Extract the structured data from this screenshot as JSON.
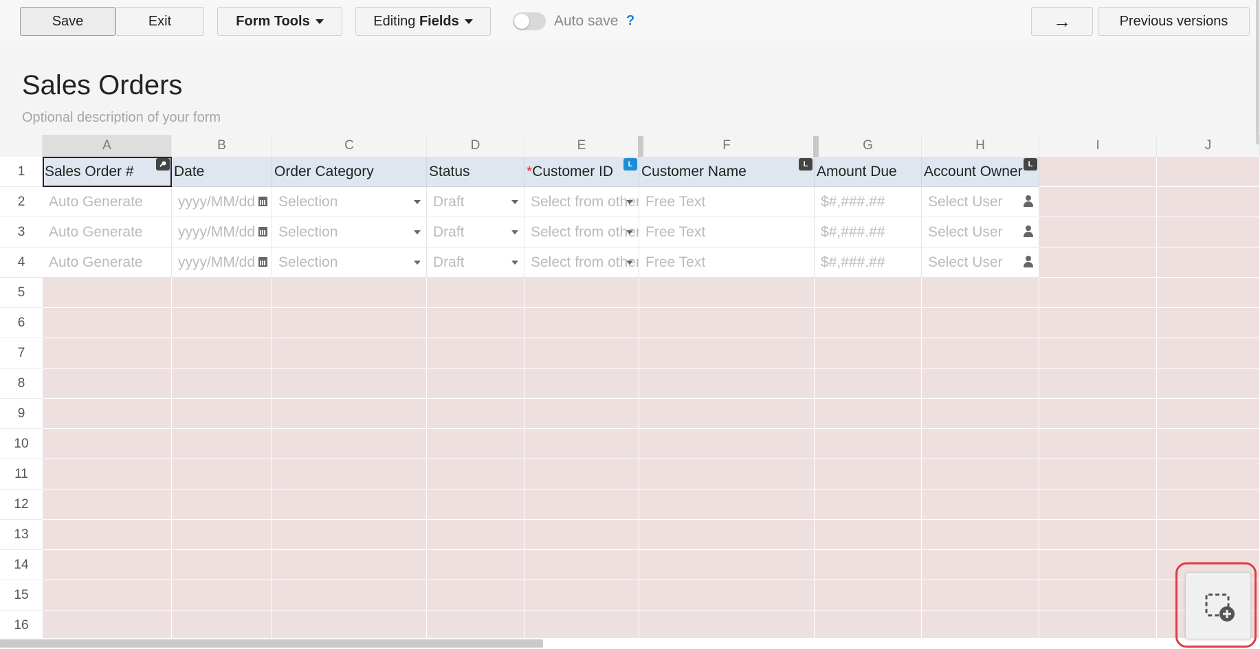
{
  "toolbar": {
    "save_label": "Save",
    "exit_label": "Exit",
    "form_tools_label": "Form Tools",
    "editing_prefix": "Editing ",
    "editing_bold": "Fields",
    "autosave_label": "Auto save",
    "autosave_enabled": false,
    "help_label": "?",
    "arrow_label": "→",
    "previous_versions_label": "Previous versions"
  },
  "form": {
    "title": "Sales Orders",
    "description": "Optional description of your form"
  },
  "grid": {
    "columns": [
      "A",
      "B",
      "C",
      "D",
      "E",
      "F",
      "G",
      "H",
      "I",
      "J"
    ],
    "rows": [
      "1",
      "2",
      "3",
      "4",
      "5",
      "6",
      "7",
      "8",
      "9",
      "10",
      "11",
      "12",
      "13",
      "14",
      "15",
      "16"
    ],
    "fields": [
      {
        "label": "Sales Order #",
        "placeholder": "Auto Generate",
        "icon": "key-icon"
      },
      {
        "label": "Date",
        "placeholder": "yyyy/MM/dd",
        "icon": "calendar-icon"
      },
      {
        "label": "Order Category",
        "placeholder": "Selection",
        "icon": "dropdown-icon"
      },
      {
        "label": "Status",
        "placeholder": "Draft",
        "icon": "dropdown-icon"
      },
      {
        "label": "Customer ID",
        "required": "*",
        "placeholder": "Select from other",
        "icon": "dropdown-icon",
        "badge": "L"
      },
      {
        "label": "Customer Name",
        "placeholder": "Free Text",
        "badge": "L"
      },
      {
        "label": "Amount Due",
        "placeholder": "$#,###.##"
      },
      {
        "label": "Account Owner",
        "placeholder": "Select User",
        "icon": "user-icon",
        "badge": "L"
      }
    ]
  },
  "colors": {
    "empty_cell": "#efe0e0",
    "header_cell": "#e0e6ef",
    "accent": "#1a8fd8",
    "highlight": "#e03b43"
  }
}
